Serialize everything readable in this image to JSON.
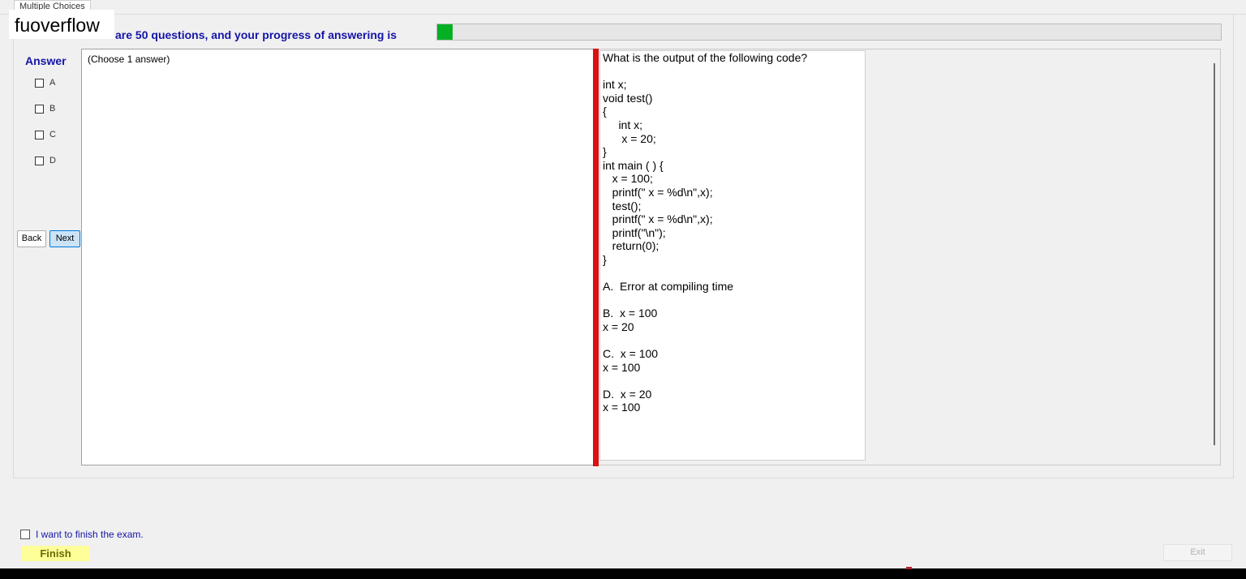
{
  "tab": {
    "label": "Multiple Choices"
  },
  "watermark": {
    "text": "fuoverflow"
  },
  "progress": {
    "text": "There are 50 questions, and your progress of answering is",
    "fraction": 0.02,
    "fill_color": "#06b025"
  },
  "answer_panel": {
    "title": "Answer",
    "options": [
      "A",
      "B",
      "C",
      "D"
    ],
    "back_label": "Back",
    "next_label": "Next"
  },
  "left_pane": {
    "instruction": "(Choose 1 answer)"
  },
  "question": {
    "text": "What is the output of the following code?\n\nint x;\nvoid test()\n{\n     int x;\n      x = 20;\n}\nint main ( ) {\n   x = 100;\n   printf(\" x = %d\\n\",x);\n   test();\n   printf(\" x = %d\\n\",x);\n   printf(\"\\n\");\n   return(0);\n}\n\nA.  Error at compiling time\n\nB.  x = 100\nx = 20\n\nC.  x = 100\nx = 100\n\nD.  x = 20\nx = 100"
  },
  "footer": {
    "finish_checkbox_label": "I want to finish the exam.",
    "finish_label": "Finish",
    "exit_label": "Exit"
  },
  "colors": {
    "accent_text": "#1515a8",
    "splitter": "#d91212",
    "finish_bg": "#ffff99"
  }
}
